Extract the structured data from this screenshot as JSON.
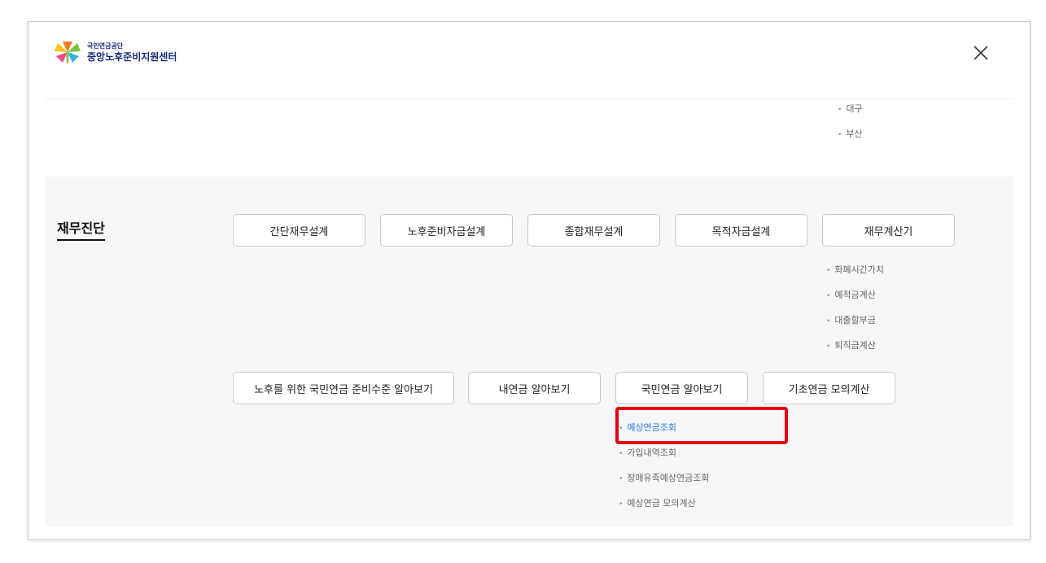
{
  "header": {
    "logo_sub": "국민연금공단",
    "logo_main": "중앙노후준비지원센터",
    "close_icon": "close-icon"
  },
  "top_sublist": [
    "대구",
    "부산"
  ],
  "section": {
    "title": "재무진단",
    "row1_buttons": [
      "간단재무설계",
      "노후준비자금설계",
      "종합재무설계",
      "목적자금설계",
      "재무계산기"
    ],
    "calculator_items": [
      "화폐시간가치",
      "예적금계산",
      "대출할부금",
      "퇴직금계산"
    ],
    "row2_buttons": [
      "노후를 위한 국민연금 준비수준 알아보기",
      "내연금 알아보기",
      "국민연금 알아보기",
      "기초연금 모의계산"
    ],
    "pension_items": [
      "예상연금조회",
      "가입내역조회",
      "장애유족예상연금조회",
      "예상연금 모의계산"
    ],
    "active_item": "예상연금조회"
  },
  "colors": {
    "active": "#2a7de1",
    "highlight": "#e3000f",
    "section_bg": "#f6f7f9"
  }
}
